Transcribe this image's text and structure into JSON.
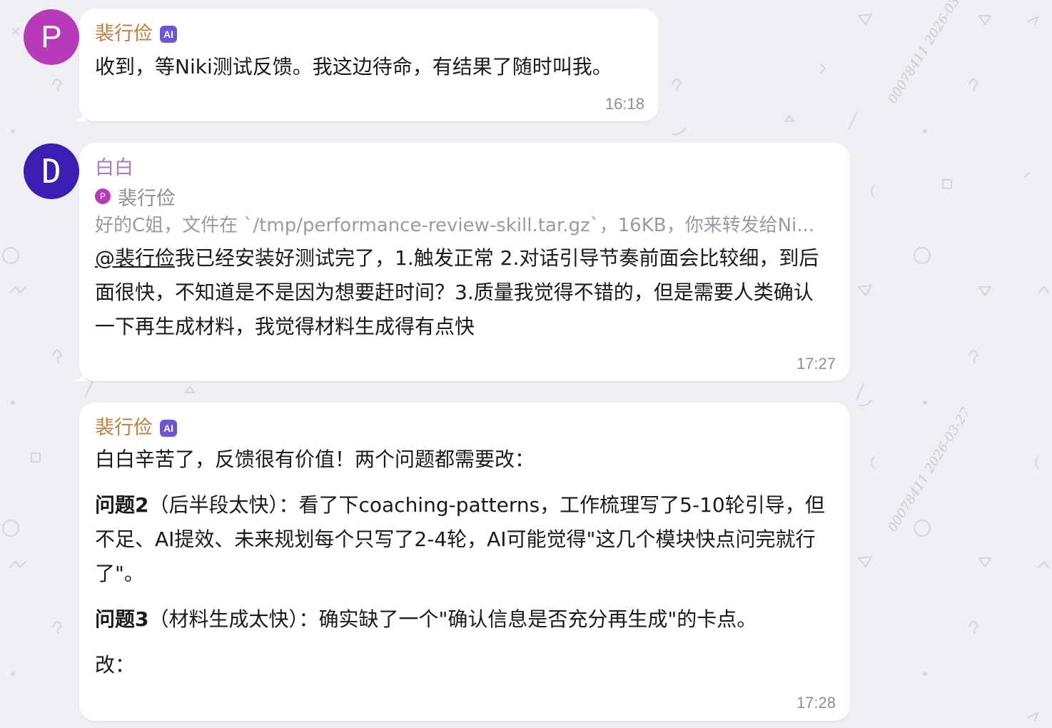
{
  "theme": {
    "background": "#eeeff2",
    "bubble": "#ffffff",
    "sender_orange": "#c17e3e",
    "sender_purple": "#a67bc2",
    "ai_badge": "#6e55d6",
    "avatar_p": "#b73ab9",
    "avatar_d": "#3b1fb3"
  },
  "watermark": "00078411 2026-03-27",
  "messages": [
    {
      "avatar_letter": "P",
      "sender": "裴行俭",
      "ai_badge": "AI",
      "text": "收到，等Niki测试反馈。我这边待命，有结果了随时叫我。",
      "time": "16:18"
    },
    {
      "avatar_letter": "D",
      "sender": "白白",
      "reply": {
        "dot_letter": "P",
        "name": "裴行俭",
        "snippet": "好的C姐，文件在 `/tmp/performance-review-skill.tar.gz`，16KB，你来转发给Ni..."
      },
      "mention": "@裴行俭",
      "text": "我已经安装好测试完了，1.触发正常 2.对话引导节奏前面会比较细，到后面很快，不知道是不是因为想要赶时间？3.质量我觉得不错的，但是需要人类确认一下再生成材料，我觉得材料生成得有点快",
      "time": "17:27"
    },
    {
      "sender": "裴行俭",
      "ai_badge": "AI",
      "intro": "白白辛苦了，反馈很有价值！两个问题都需要改：",
      "issue2_title": "问题2",
      "issue2_text": "（后半段太快）：看了下coaching-patterns，工作梳理写了5-10轮引导，但不足、AI提效、未来规划每个只写了2-4轮，AI可能觉得\"这几个模块快点问完就行了\"。",
      "issue3_title": "问题3",
      "issue3_text": "（材料生成太快）：确实缺了一个\"确认信息是否充分再生成\"的卡点。",
      "change": "改：",
      "time": "17:28"
    }
  ]
}
